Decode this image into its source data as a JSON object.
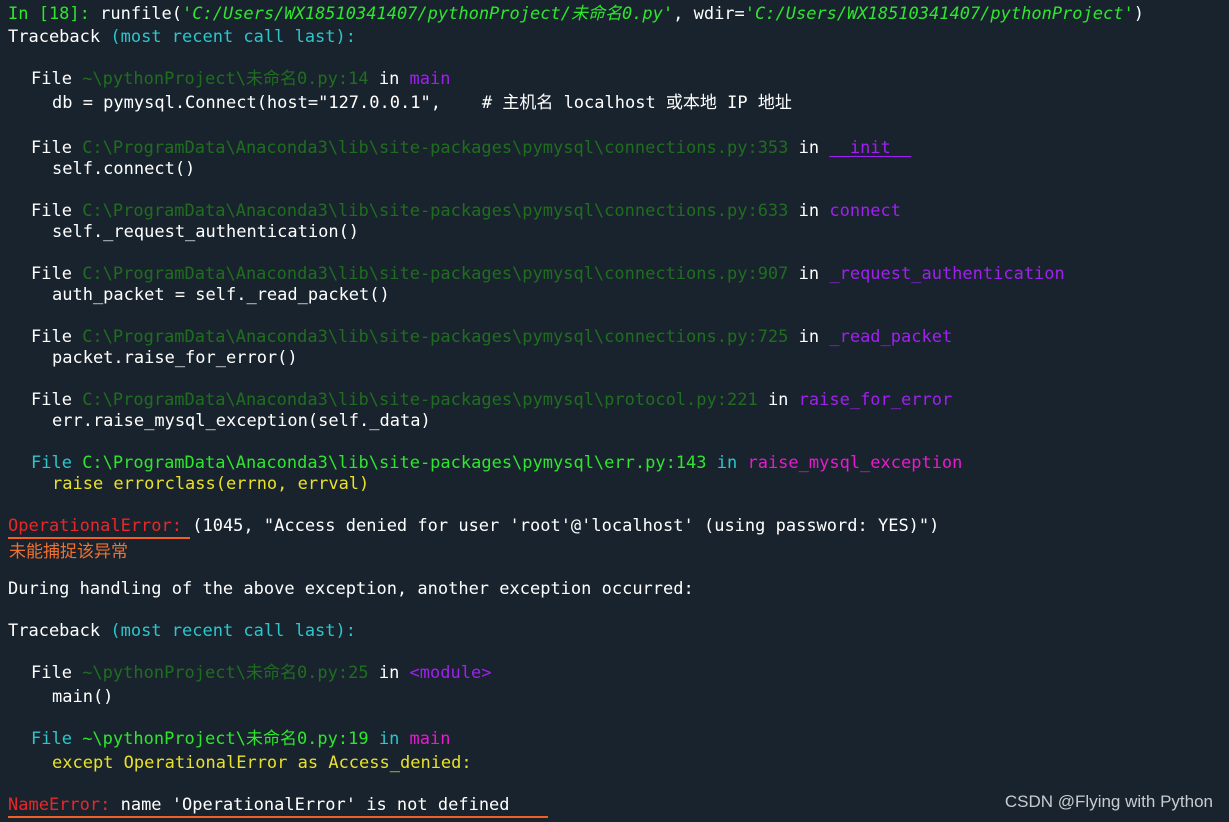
{
  "prompt": {
    "label": "In [18]:",
    "cmd_start": " runfile(",
    "arg1": "'C:/Users/WX18510341407/pythonProject/未命名0.py'",
    "sep": ", wdir=",
    "arg2": "'C:/Users/WX18510341407/pythonProject'",
    "cmd_end": ")"
  },
  "traceback1": {
    "head": "Traceback ",
    "head_paren": "(most recent call last):",
    "frames": [
      {
        "file": "File ",
        "path": "~\\pythonProject\\未命名0.py:14",
        "in": " in ",
        "func": "main",
        "code": "db = pymysql.Connect(host=\"127.0.0.1\",    # 主机名 localhost 或本地 IP 地址"
      },
      {
        "file": "File ",
        "path": "C:\\ProgramData\\Anaconda3\\lib\\site-packages\\pymysql\\connections.py:353",
        "in": " in ",
        "func": "__init__",
        "code": "self.connect()"
      },
      {
        "file": "File ",
        "path": "C:\\ProgramData\\Anaconda3\\lib\\site-packages\\pymysql\\connections.py:633",
        "in": " in ",
        "func": "connect",
        "code": "self._request_authentication()"
      },
      {
        "file": "File ",
        "path": "C:\\ProgramData\\Anaconda3\\lib\\site-packages\\pymysql\\connections.py:907",
        "in": " in ",
        "func": "_request_authentication",
        "code": "auth_packet = self._read_packet()"
      },
      {
        "file": "File ",
        "path": "C:\\ProgramData\\Anaconda3\\lib\\site-packages\\pymysql\\connections.py:725",
        "in": " in ",
        "func": "_read_packet",
        "code": "packet.raise_for_error()"
      },
      {
        "file": "File ",
        "path": "C:\\ProgramData\\Anaconda3\\lib\\site-packages\\pymysql\\protocol.py:221",
        "in": " in ",
        "func": "raise_for_error",
        "code": "err.raise_mysql_exception(self._data)"
      },
      {
        "file": "File ",
        "path": "C:\\ProgramData\\Anaconda3\\lib\\site-packages\\pymysql\\err.py:143",
        "in": " in ",
        "func": "raise_mysql_exception",
        "code": "raise errorclass(errno, errval)"
      }
    ]
  },
  "error1": {
    "name": "OperationalError:",
    "message": " (1045, \"Access denied for user 'root'@'localhost' (using password: YES)\")"
  },
  "note": "未能捕捉该异常",
  "during": "During handling of the above exception, another exception occurred:",
  "traceback2": {
    "head": "Traceback ",
    "head_paren": "(most recent call last):",
    "frames": [
      {
        "file": "File ",
        "path": "~\\pythonProject\\未命名0.py:25",
        "in": " in ",
        "func": "<module>",
        "code": "main()"
      },
      {
        "file": "File ",
        "path": "~\\pythonProject\\未命名0.py:19",
        "in": " in ",
        "func": "main",
        "code": "except OperationalError as Access_denied:"
      }
    ]
  },
  "error2": {
    "name": "NameError:",
    "message": " name 'OperationalError' is not defined"
  },
  "watermark": "CSDN @Flying with Python",
  "colors": {
    "background": "#19232d",
    "highlight_underline": "#f06020",
    "note": "#f07030"
  }
}
